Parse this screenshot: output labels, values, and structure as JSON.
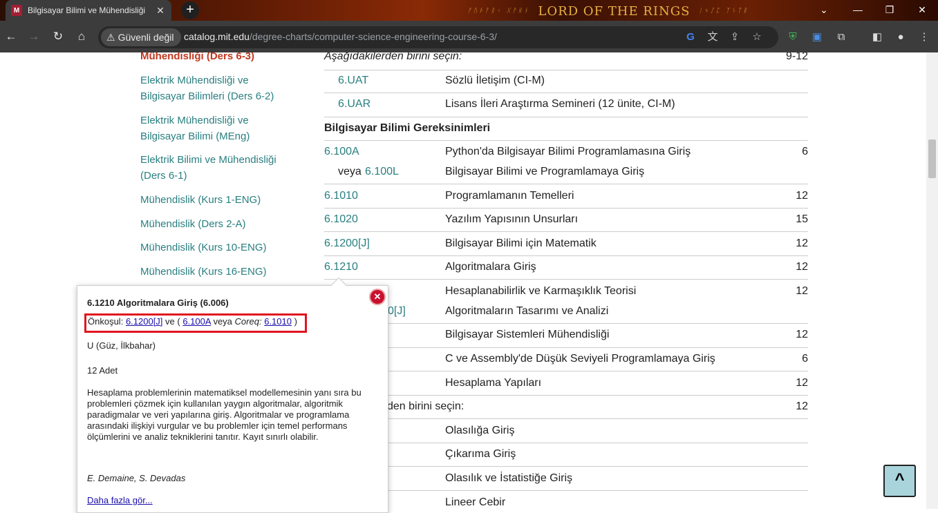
{
  "browser": {
    "tab_title": "Bilgisayar Bilimi ve Mühendisliği",
    "new_tab": "+",
    "banner_text": "LORD OF THE RINGS",
    "security_label": "Güvenli değil",
    "url_host": "catalog.mit.edu",
    "url_path": "/degree-charts/computer-science-engineering-course-6-3/"
  },
  "sidebar": {
    "items": [
      {
        "label": "Mühendisliği (Ders 6-3)",
        "active": true
      },
      {
        "label": "Elektrik Mühendisliği ve Bilgisayar Bilimleri (Ders 6-2)"
      },
      {
        "label": "Elektrik Mühendisliği ve Bilgisayar Bilimi (MEng)"
      },
      {
        "label": "Elektrik Bilimi ve Mühendisliği (Ders 6-1)"
      },
      {
        "label": "Mühendislik (Kurs 1-ENG)"
      },
      {
        "label": "Mühendislik (Ders 2-A)"
      },
      {
        "label": "Mühendislik (Kurs 10-ENG)"
      },
      {
        "label": "Mühendislik (Kurs 16-ENG)"
      }
    ]
  },
  "table": {
    "choose_one_1": "Aşağıdakilerden birini seçin:",
    "choose_one_1_units": "9-12",
    "uat_code": "6.UAT",
    "uat_title": "Sözlü İletişim (CI-M)",
    "uar_code": "6.UAR",
    "uar_title": "Lisans İleri Araştırma Semineri (12 ünite, CI-M)",
    "section_cs": "Bilgisayar Bilimi Gereksinimleri",
    "r100a_code": "6.100A",
    "r100a_title": "Python'da Bilgisayar Bilimi Programlamasına Giriş",
    "r100a_units": "6",
    "r100l_or": "veya",
    "r100l_code": "6.100L",
    "r100l_title": "Bilgisayar Bilimi ve Programlamaya Giriş",
    "r1010_code": "6.1010",
    "r1010_title": "Programlamanın Temelleri",
    "r1010_units": "12",
    "r1020_code": "6.1020",
    "r1020_title": "Yazılım Yapısının Unsurları",
    "r1020_units": "15",
    "r1200_code": "6.1200[J]",
    "r1200_title": "Bilgisayar Bilimi için Matematik",
    "r1200_units": "12",
    "r1210_code": "6.1210",
    "r1210_title": "Algoritmalara Giriş",
    "r1210_units": "12",
    "r_hesap_title": "Hesaplanabilirlik ve Karmaşıklık Teorisi",
    "r_hesap_units": "12",
    "r_algo_code_tail": "0[J]",
    "r_algo_title": "Algoritmaların Tasarımı ve Analizi",
    "r_sys_title": "Bilgisayar Sistemleri Mühendisliği",
    "r_sys_units": "12",
    "r_c_title": "C ve Assembly'de Düşük Seviyeli Programlamaya Giriş",
    "r_c_units": "6",
    "r_comp_title": "Hesaplama Yapıları",
    "r_comp_units": "12",
    "choose_one_2": "den birini seçin:",
    "choose_one_2_units": "12",
    "r_olas_title": "Olasılığa Giriş",
    "r_cik_title": "Çıkarıma Giriş",
    "r_ist_title": "Olasılık ve İstatistiğe Giriş",
    "r_lin_title": "Lineer Cebir"
  },
  "popup": {
    "title": "6.1210 Algoritmalara Giriş (6.006)",
    "prereq_label": "Önkoşul:",
    "prereq_link1": "6.1200[J]",
    "prereq_and": " ve ( ",
    "prereq_link2": "6.100A",
    "prereq_or": " veya ",
    "prereq_coreq": "Coreq:",
    "prereq_link3": "6.1010",
    "prereq_close": " )",
    "term": "U (Güz, İlkbahar)",
    "units": "12 Adet",
    "description": "Hesaplama problemlerinin matematiksel modellemesinin yanı sıra bu problemleri çözmek için kullanılan yaygın algoritmalar, algoritmik paradigmalar ve veri yapılarına giriş. Algoritmalar ve programlama arasındaki ilişkiyi vurgular ve bu problemler için temel performans ölçümlerini ve analiz tekniklerini tanıtır. Kayıt sınırlı olabilir.",
    "instructors": "E. Demaine, S. Devadas",
    "more_link": "Daha fazla gör..."
  },
  "back_to_top": "^"
}
